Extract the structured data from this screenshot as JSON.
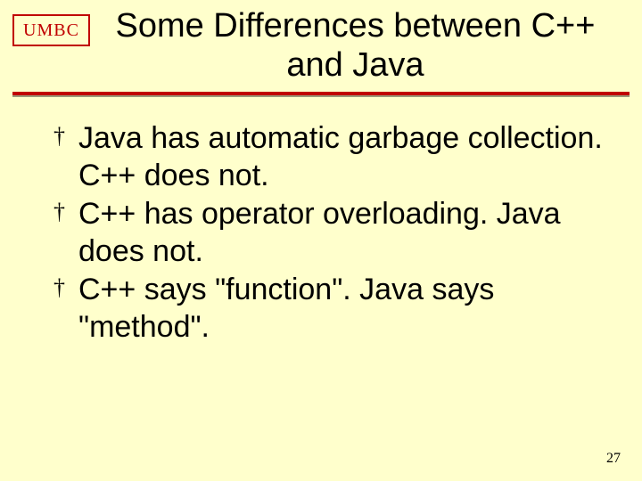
{
  "header": {
    "badge": "UMBC",
    "title": "Some Differences between C++ and Java"
  },
  "bullets": [
    "Java has automatic garbage collection. C++ does not.",
    "C++ has operator overloading. Java does not.",
    "C++ says \"function\". Java says \"method\"."
  ],
  "page_number": "27",
  "colors": {
    "background": "#ffffcc",
    "accent": "#c00000"
  }
}
